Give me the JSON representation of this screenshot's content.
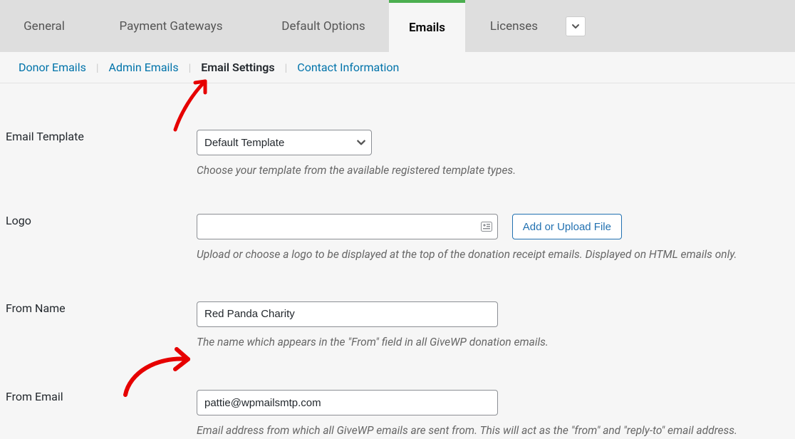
{
  "tabs": {
    "general": "General",
    "payment_gateways": "Payment Gateways",
    "default_options": "Default Options",
    "emails": "Emails",
    "licenses": "Licenses"
  },
  "subtabs": {
    "donor_emails": "Donor Emails",
    "admin_emails": "Admin Emails",
    "email_settings": "Email Settings",
    "contact_info": "Contact Information"
  },
  "fields": {
    "email_template": {
      "label": "Email Template",
      "value": "Default Template",
      "help": "Choose your template from the available registered template types."
    },
    "logo": {
      "label": "Logo",
      "value": "",
      "button": "Add or Upload File",
      "help": "Upload or choose a logo to be displayed at the top of the donation receipt emails. Displayed on HTML emails only."
    },
    "from_name": {
      "label": "From Name",
      "value": "Red Panda Charity",
      "help": "The name which appears in the \"From\" field in all GiveWP donation emails."
    },
    "from_email": {
      "label": "From Email",
      "value": "pattie@wpmailsmtp.com",
      "help": "Email address from which all GiveWP emails are sent from. This will act as the \"from\" and \"reply-to\" email address."
    }
  }
}
